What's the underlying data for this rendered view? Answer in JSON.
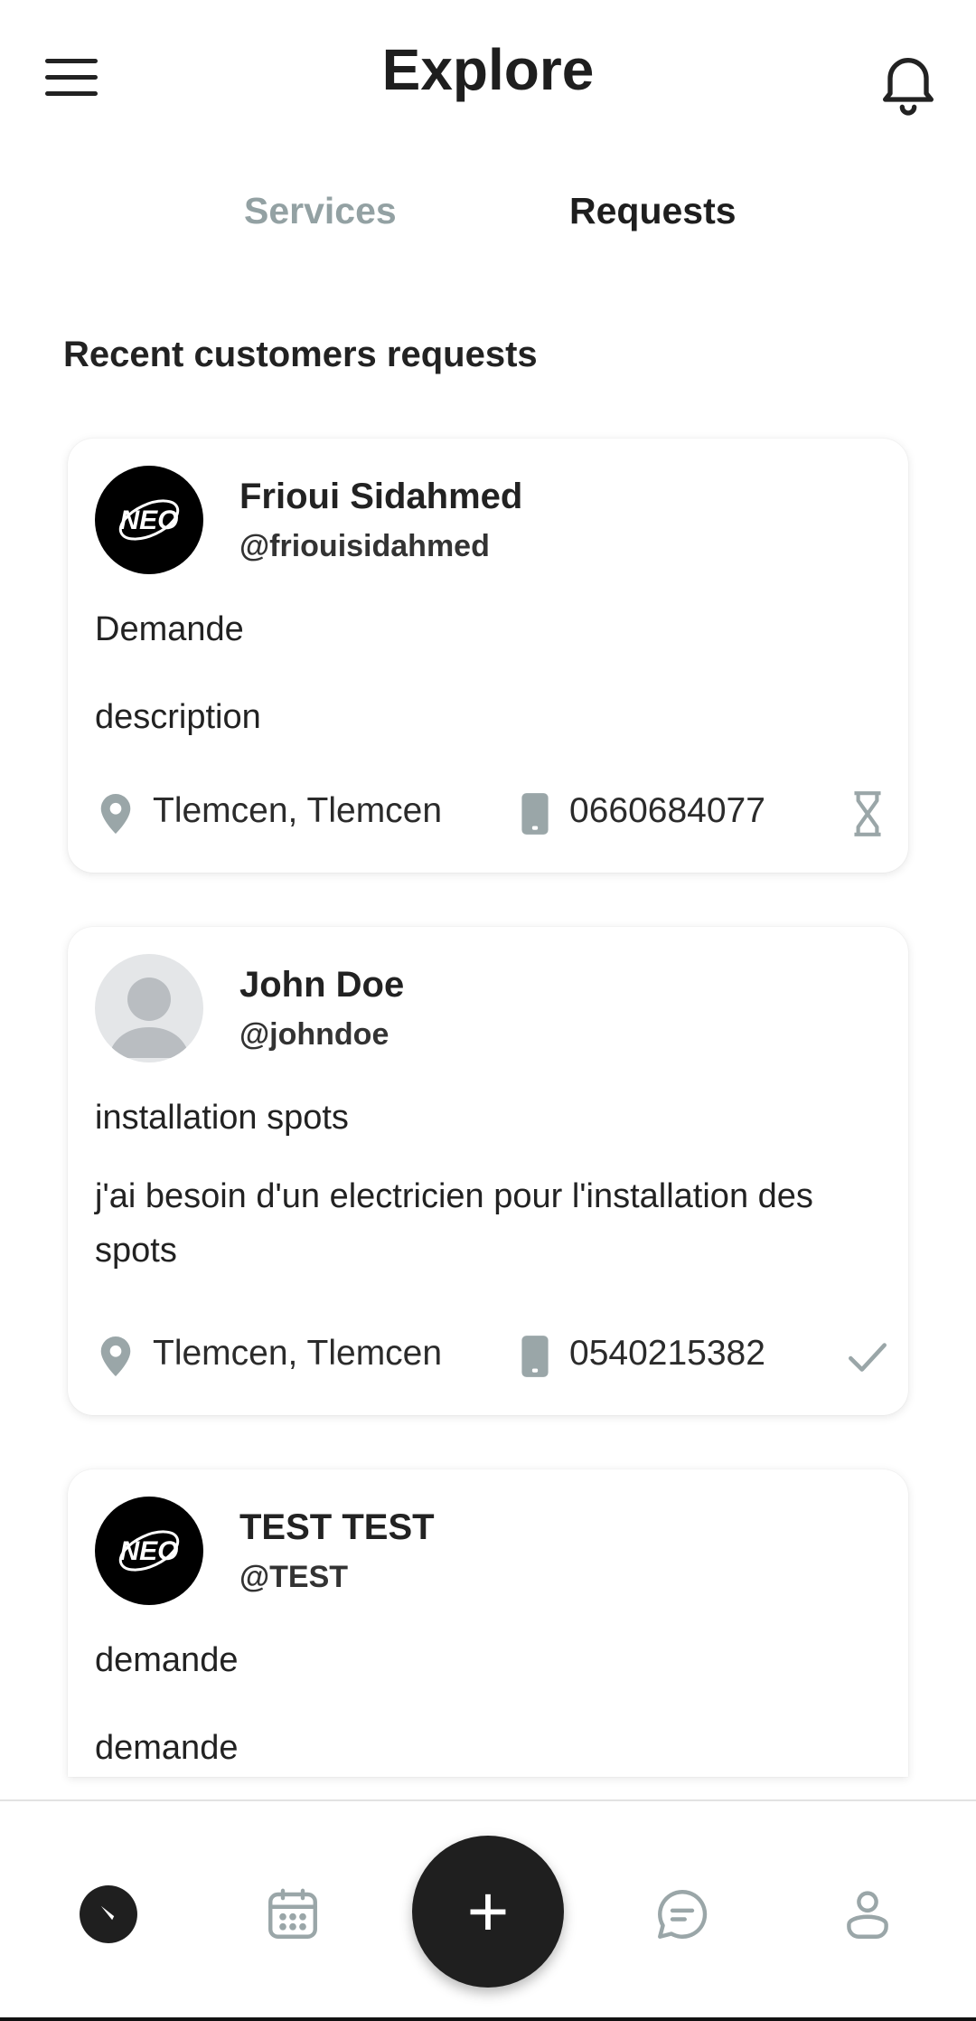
{
  "header": {
    "title": "Explore",
    "menu_icon": "hamburger-menu-icon",
    "notification_icon": "bell-icon"
  },
  "tabs": [
    {
      "label": "Services",
      "active": false
    },
    {
      "label": "Requests",
      "active": true
    }
  ],
  "section_title": "Recent customers requests",
  "requests": [
    {
      "name": "Frioui Sidahmed",
      "handle": "@friouisidahmed",
      "avatar": "neo-logo",
      "title": "Demande",
      "description": "description",
      "location": "Tlemcen, Tlemcen",
      "phone": "0660684077",
      "status_icon": "hourglass-icon"
    },
    {
      "name": "John Doe",
      "handle": "@johndoe",
      "avatar": "default-user",
      "title": "installation spots",
      "description": "j'ai besoin d'un electricien pour l'installation des spots",
      "location": "Tlemcen, Tlemcen",
      "phone": "0540215382",
      "status_icon": "check-icon"
    },
    {
      "name": "TEST TEST",
      "handle": "@TEST",
      "avatar": "neo-logo",
      "title": "demande",
      "description": "demande"
    }
  ],
  "bottom_nav": {
    "items": [
      "explore-icon",
      "calendar-icon",
      "add-icon",
      "chat-icon",
      "profile-icon"
    ],
    "fab_label": "+"
  },
  "colors": {
    "accent": "#1f1f1f",
    "inactive_tab": "#93a1a3",
    "icon_gray": "#9aa6a8"
  }
}
